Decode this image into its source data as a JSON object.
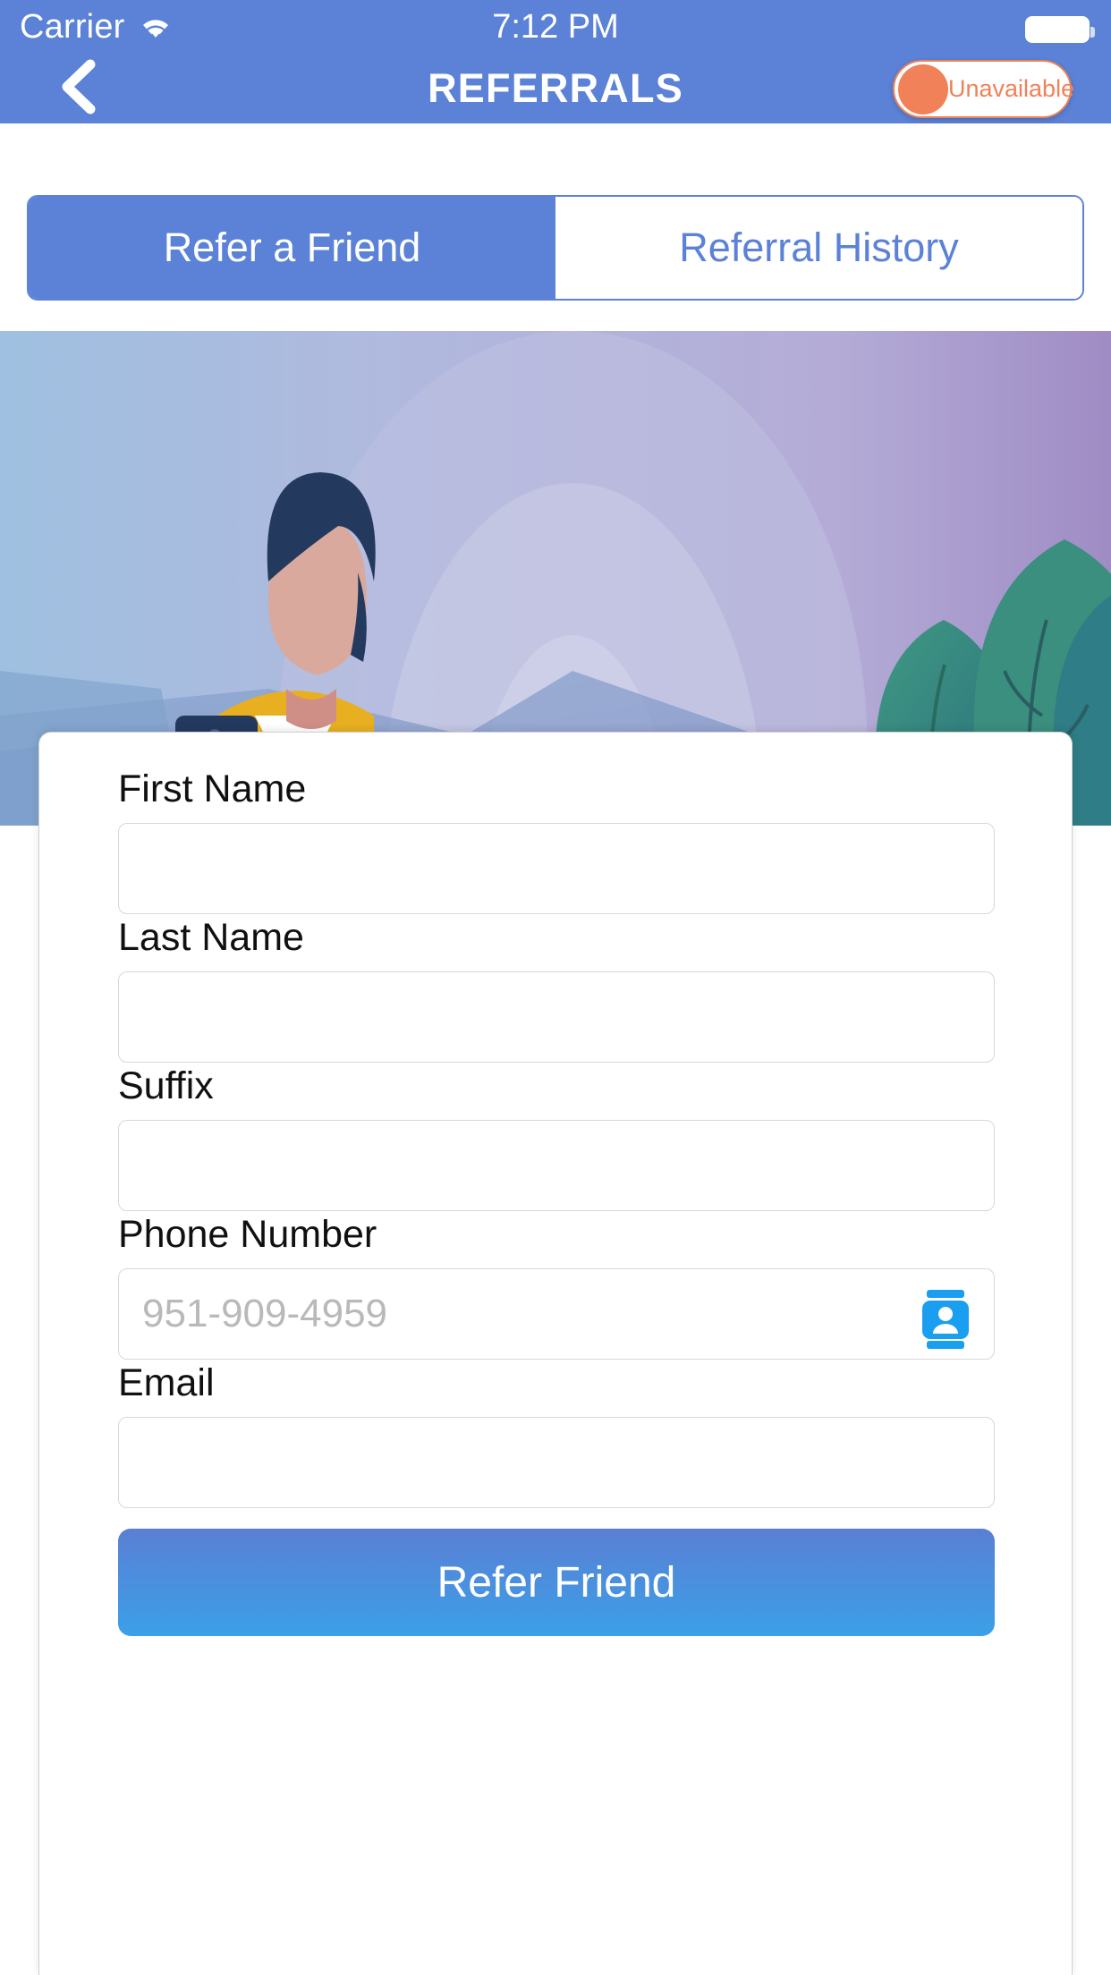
{
  "status_bar": {
    "carrier": "Carrier",
    "wifi_icon": "wifi-icon",
    "time": "7:12 PM",
    "battery_icon": "battery-full-icon"
  },
  "header": {
    "back_icon": "chevron-left-icon",
    "title": "REFERRALS",
    "availability": {
      "label": "Unavailable",
      "state": "off",
      "accent_color": "#f08158"
    },
    "background_color": "#5b82d6"
  },
  "tabs": [
    {
      "label": "Refer a Friend",
      "active": true
    },
    {
      "label": "Referral History",
      "active": false
    }
  ],
  "hero": {
    "alt": "illustration of a person holding a phone outdoors",
    "colors": {
      "sky": "#b3b6dd",
      "shirt": "#e8b020",
      "hair": "#23395e",
      "tree": "#3e8f7c"
    }
  },
  "form": {
    "fields": [
      {
        "label": "First Name",
        "value": "",
        "placeholder": "",
        "icon": null
      },
      {
        "label": "Last Name",
        "value": "",
        "placeholder": "",
        "icon": null
      },
      {
        "label": "Suffix",
        "value": "",
        "placeholder": "",
        "icon": null
      },
      {
        "label": "Phone Number",
        "value": "",
        "placeholder": "951-909-4959",
        "icon": "contacts-icon"
      },
      {
        "label": "Email",
        "value": "",
        "placeholder": "",
        "icon": null
      }
    ],
    "submit_label": "Refer Friend",
    "submit_gradient": [
      "#5a7fd4",
      "#3ba0e8"
    ]
  }
}
